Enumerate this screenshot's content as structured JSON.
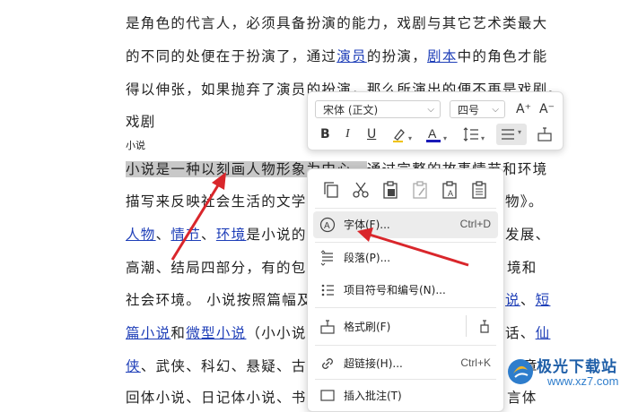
{
  "document": {
    "line1": "是角色的代言人，必须具备扮演的能力，戏剧与其它艺术类最大",
    "line2_a": "的不同的处便在于扮演了，通过",
    "line2_link1": "演员",
    "line2_b": "的扮演，",
    "line2_link2": "剧本",
    "line2_c": "中的角色才能",
    "line3": "得以伸张，如果抛弃了演员的扮演，那么所演出的便不再是戏剧。",
    "line4": "戏剧",
    "heading_small": "小说",
    "line6_highlight": "小说是一种以刻画人物形象为中心，",
    "line6_rest": "通过完整的故事情节和环境",
    "line7_a": "描写来反映社会生活的文学体",
    "line7_b": "物》。",
    "line8_link1": "人物",
    "line8_sep1": "、",
    "line8_link2": "情节",
    "line8_sep2": "、",
    "line8_link3": "环境",
    "line8_b": "是小说的三",
    "line8_c": "发展、",
    "line9_a": "高潮、结局四部分，有的包括",
    "line9_b": "境和",
    "line10_a": "社会环境。 小说按照篇幅及",
    "line10_link": "说",
    "line10_b": "、",
    "line10_link2": "短",
    "line11_link1": "篇小说",
    "line11_a": "和",
    "line11_link2": "微型小说",
    "line11_b": "（小小说）",
    "line11_c": "话、",
    "line11_link3": "仙",
    "line12_link": "侠",
    "line12_a": "、武侠、科幻、悬疑、古代",
    "line12_b": "章",
    "line13_a": "回体小说、日记体小说、书信",
    "line13_b": "言体"
  },
  "mini_toolbar": {
    "font_name": "宋体 (正文)",
    "font_size": "四号",
    "grow_font": "A⁺",
    "shrink_font": "A⁻",
    "bold": "B",
    "italic": "I",
    "underline": "U"
  },
  "context_menu": {
    "items": [
      {
        "label": "字体(F)...",
        "shortcut": "Ctrl+D",
        "icon": "font-icon"
      },
      {
        "label": "段落(P)...",
        "shortcut": "",
        "icon": "paragraph-icon"
      },
      {
        "label": "项目符号和编号(N)...",
        "shortcut": "",
        "icon": "bullets-icon"
      },
      {
        "label": "格式刷(F)",
        "shortcut": "",
        "icon": "format-painter-icon"
      },
      {
        "label": "超链接(H)...",
        "shortcut": "Ctrl+K",
        "icon": "hyperlink-icon"
      },
      {
        "label": "插入批注(T)",
        "shortcut": "",
        "icon": "comment-icon"
      }
    ]
  },
  "watermark": {
    "title": "极光下载站",
    "url": "www.xz7.com"
  },
  "colors": {
    "link": "#1f3fb8",
    "arrow": "#d9262b",
    "highlight": "#c8c8c8",
    "menu_hover": "#ececec"
  }
}
